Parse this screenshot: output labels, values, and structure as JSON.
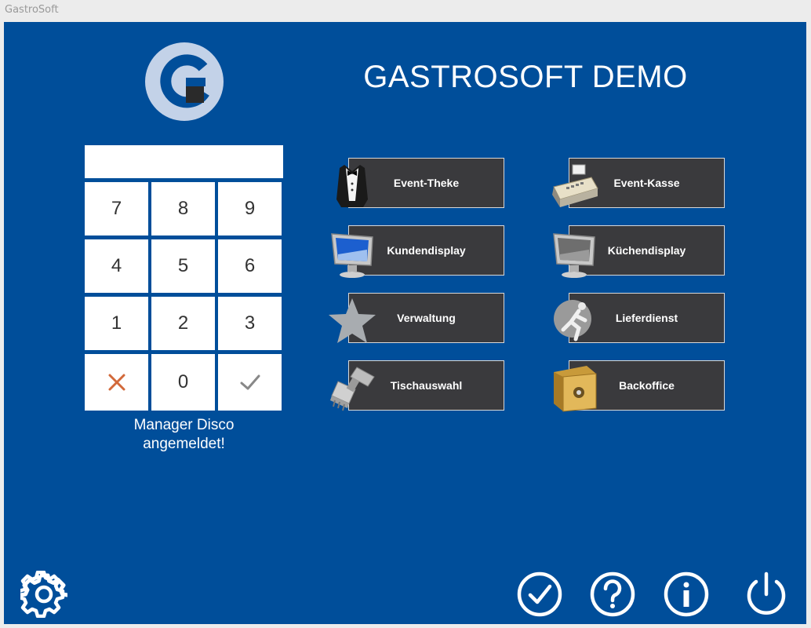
{
  "window": {
    "title": "GastroSoft"
  },
  "header": {
    "app_title": "GASTROSOFT DEMO"
  },
  "login": {
    "pin_value": "",
    "keys": [
      "7",
      "8",
      "9",
      "4",
      "5",
      "6",
      "1",
      "2",
      "3"
    ],
    "zero_key": "0",
    "status_line1": "Manager Disco",
    "status_line2": "angemeldet!"
  },
  "menu": {
    "left": [
      {
        "label": "Event-Theke",
        "icon": "tuxedo-icon"
      },
      {
        "label": "Kundendisplay",
        "icon": "monitor-icon"
      },
      {
        "label": "Verwaltung",
        "icon": "star-icon"
      },
      {
        "label": "Tischauswahl",
        "icon": "brush-icon"
      }
    ],
    "right": [
      {
        "label": "Event-Kasse",
        "icon": "cash-register-icon"
      },
      {
        "label": "Küchendisplay",
        "icon": "monitor-icon"
      },
      {
        "label": "Lieferdienst",
        "icon": "delivery-icon"
      },
      {
        "label": "Backoffice",
        "icon": "safe-icon"
      }
    ]
  },
  "footer": {
    "icons": [
      "gear-icon",
      "check-circle-icon",
      "help-icon",
      "info-icon",
      "power-icon"
    ]
  },
  "colors": {
    "background": "#004e9a",
    "button": "#3a3a3d",
    "cancel": "#d2693a",
    "confirm": "#888888"
  }
}
